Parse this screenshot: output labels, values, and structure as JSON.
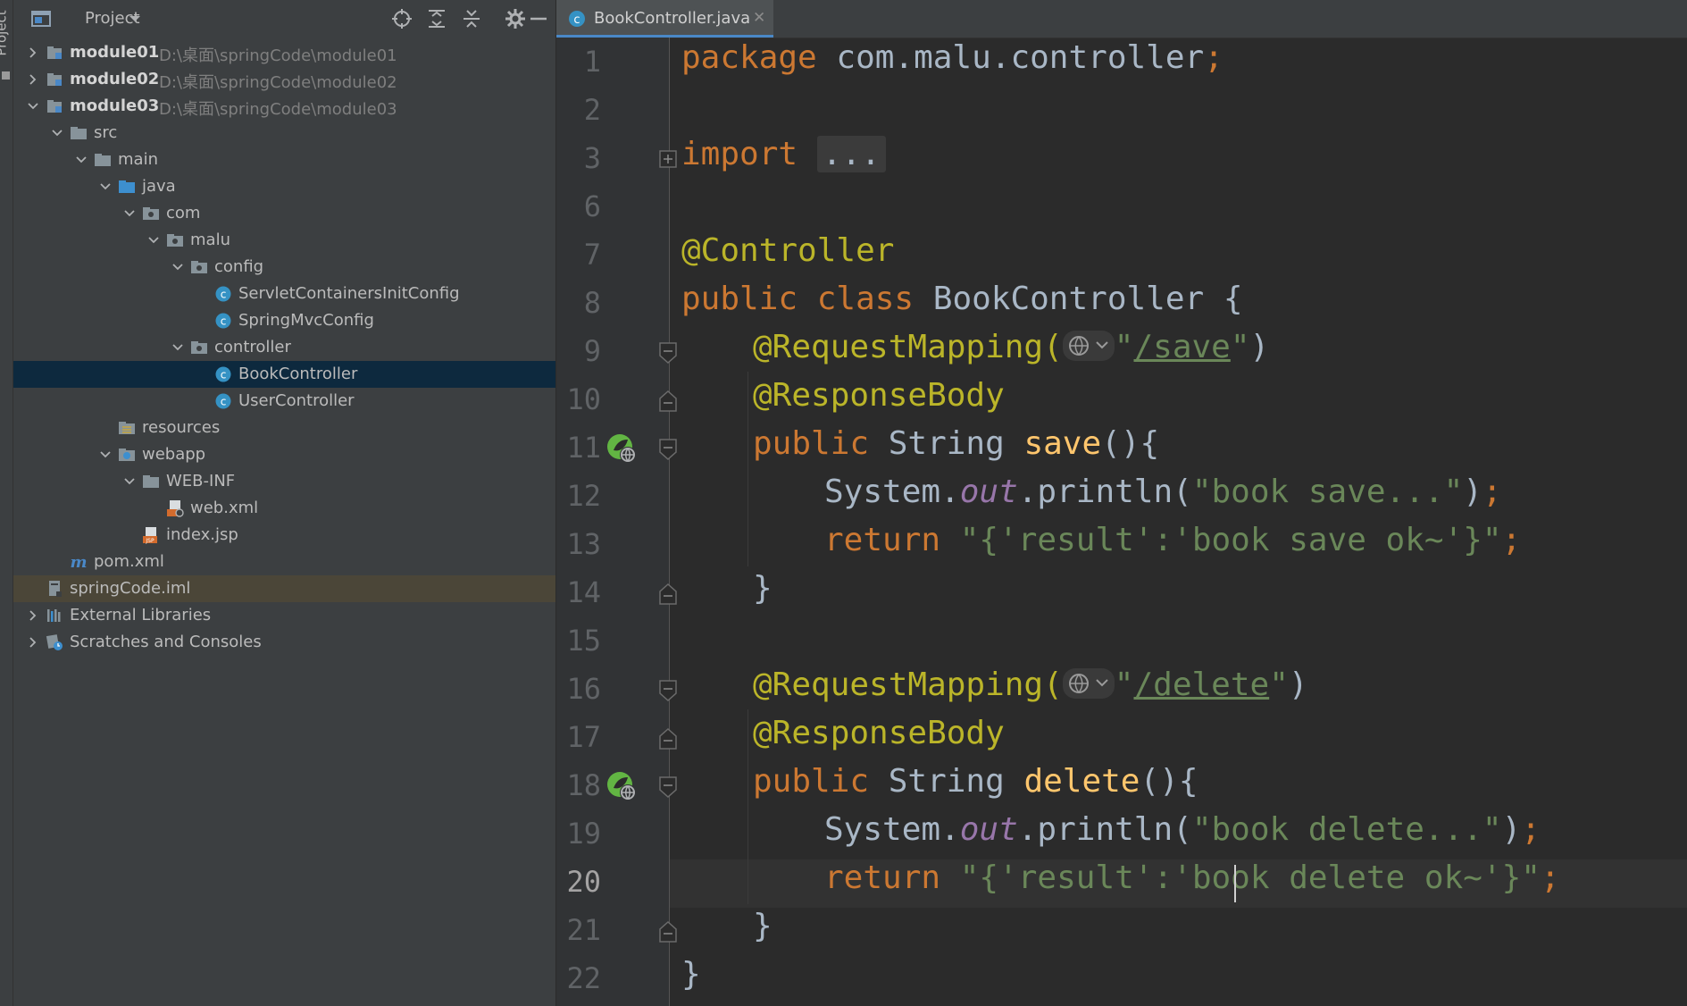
{
  "window": {
    "side_stripe_label": "Project"
  },
  "project_panel": {
    "title": "Project",
    "toolbar_icons": [
      "locate-icon",
      "expand-all-icon",
      "collapse-all-icon",
      "gear-icon",
      "minimize-icon"
    ],
    "tree": [
      {
        "label": "module01",
        "path": "D:\\桌面\\springCode\\module01",
        "icon": "module-folder-icon",
        "expanded": false
      },
      {
        "label": "module02",
        "path": "D:\\桌面\\springCode\\module02",
        "icon": "module-folder-icon",
        "expanded": false
      },
      {
        "label": "module03",
        "path": "D:\\桌面\\springCode\\module03",
        "icon": "module-folder-icon",
        "expanded": true
      },
      {
        "label": "src",
        "icon": "folder-icon",
        "expanded": true
      },
      {
        "label": "main",
        "icon": "folder-icon",
        "expanded": true
      },
      {
        "label": "java",
        "icon": "source-folder-icon",
        "expanded": true
      },
      {
        "label": "com",
        "icon": "package-icon",
        "expanded": true
      },
      {
        "label": "malu",
        "icon": "package-icon",
        "expanded": true
      },
      {
        "label": "config",
        "icon": "package-icon",
        "expanded": true
      },
      {
        "label": "ServletContainersInitConfig",
        "icon": "java-class-icon"
      },
      {
        "label": "SpringMvcConfig",
        "icon": "java-class-icon"
      },
      {
        "label": "controller",
        "icon": "package-icon",
        "expanded": true
      },
      {
        "label": "BookController",
        "icon": "java-class-icon",
        "selected": true
      },
      {
        "label": "UserController",
        "icon": "java-class-icon"
      },
      {
        "label": "resources",
        "icon": "resources-folder-icon"
      },
      {
        "label": "webapp",
        "icon": "web-folder-icon",
        "expanded": true
      },
      {
        "label": "WEB-INF",
        "icon": "folder-icon",
        "expanded": true
      },
      {
        "label": "web.xml",
        "icon": "web-xml-icon"
      },
      {
        "label": "index.jsp",
        "icon": "jsp-file-icon"
      },
      {
        "label": "pom.xml",
        "icon": "maven-icon"
      },
      {
        "label": "springCode.iml",
        "icon": "iml-file-icon"
      },
      {
        "label": "External Libraries",
        "icon": "libraries-icon",
        "expanded": false
      },
      {
        "label": "Scratches and Consoles",
        "icon": "scratches-icon",
        "expanded": false
      }
    ]
  },
  "editor": {
    "tab": {
      "label": "BookController.java",
      "close": "✕",
      "icon": "java-class-icon"
    },
    "current_line": "20",
    "line_numbers": [
      "1",
      "2",
      "3",
      "6",
      "7",
      "8",
      "9",
      "10",
      "11",
      "12",
      "13",
      "14",
      "15",
      "16",
      "17",
      "18",
      "19",
      "20",
      "21",
      "22"
    ],
    "code": {
      "l1_kw": "package",
      "l1_rest": " com.malu.controller",
      "semi": ";",
      "l3_kw": "import",
      "l3_fold": "...",
      "l7_ann": "@Controller",
      "l8_kw": "public class",
      "l8_rest": " BookController {",
      "req_mapping": "@RequestMapping(",
      "quote": "\"",
      "l9_url": "/save",
      "close_paren": ")",
      "response_body": "@ResponseBody",
      "public": "public",
      "string_type": " String ",
      "l11_fn": "save",
      "method_open": "(){",
      "system": "System.",
      "out": "out",
      "println": ".println(",
      "l12_str": "\"book save...\"",
      "println_close": ");",
      "return": "return",
      "l13_str": "\"{'result':'book save ok~'}\"",
      "close_brace": "}",
      "l16_url": "/delete",
      "l18_fn": "delete",
      "l19_str": "\"book delete...\"",
      "l20_str": "\"{'result':'book delete ok~'}\""
    }
  },
  "colors": {
    "keyword": "#cc7832",
    "annotation": "#bbb529",
    "string": "#6a8759",
    "function": "#ffc66d",
    "field": "#9876aa",
    "selection": "#0d293e",
    "accent": "#4a88c7"
  }
}
